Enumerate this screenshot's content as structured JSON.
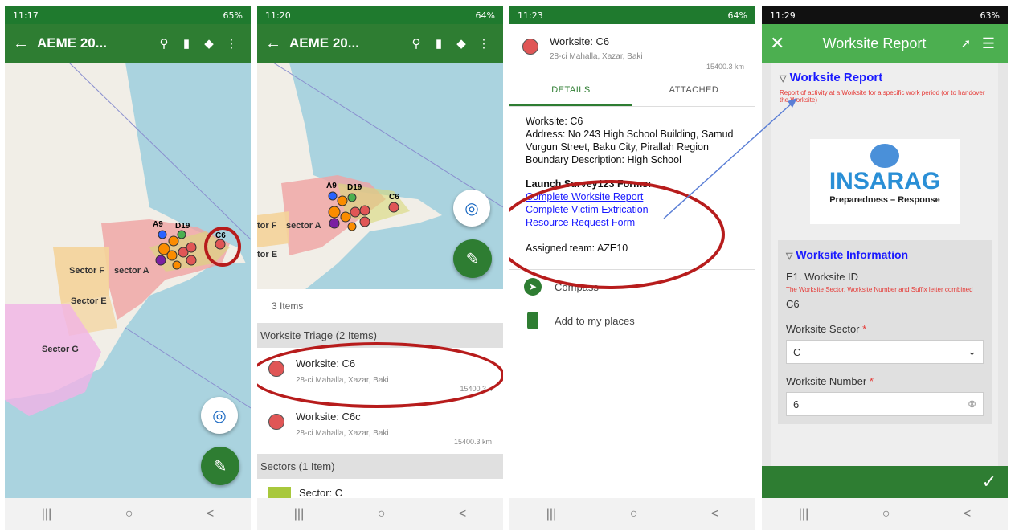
{
  "phone1": {
    "status": {
      "time": "11:17",
      "battery": "65%"
    },
    "appbar": {
      "title": "AEME 20..."
    },
    "map": {
      "labels": {
        "a9": "A9",
        "d19": "D19",
        "c6": "C6",
        "sector_f": "Sector F",
        "sector_a": "sector A",
        "sector_e": "Sector E",
        "sector_g": "Sector G"
      }
    }
  },
  "phone2": {
    "status": {
      "time": "11:20",
      "battery": "64%"
    },
    "appbar": {
      "title": "AEME 20..."
    },
    "map": {
      "labels": {
        "a9": "A9",
        "d19": "D19",
        "c6": "C6",
        "sector_f": "tor F",
        "sector_a": "sector A",
        "sector_e": "tor E"
      }
    },
    "list": {
      "count": "3 Items",
      "triage_header": "Worksite Triage (2 Items)",
      "items": [
        {
          "title": "Worksite: C6",
          "address": "28-ci Mahalla, Xazar, Baki",
          "distance": "15400.3 k"
        },
        {
          "title": "Worksite: C6c",
          "address": "28-ci Mahalla, Xazar, Baki",
          "distance": "15400.3 km"
        }
      ],
      "sectors_header": "Sectors (1 Item)",
      "sector_item": "Sector: C",
      "sector_color": "#a8c83c"
    }
  },
  "phone3": {
    "status": {
      "time": "11:23",
      "battery": "64%"
    },
    "header": {
      "title": "Worksite: C6",
      "address": "28-ci Mahalla, Xazar, Baki",
      "distance": "15400.3 km"
    },
    "tabs": {
      "details": "DETAILS",
      "attached": "ATTACHED"
    },
    "details": {
      "worksite": "Worksite: C6",
      "address": "Address: No 243 High School Building, Samud Vurgun Street, Baku City, Pirallah Region",
      "boundary": "Boundary Description: High School",
      "launch": "Launch Survey123 Forms:",
      "link1": "Complete Worksite Report",
      "link2": "Complete Victim Extrication",
      "link3": "Resource Request Form",
      "team": "Assigned team: AZE10"
    },
    "actions": {
      "compass": "Compass",
      "places": "Add to my places"
    }
  },
  "phone4": {
    "status": {
      "time": "11:29",
      "battery": "63%"
    },
    "appbar": {
      "title": "Worksite Report"
    },
    "form": {
      "header": "Worksite Report",
      "desc": "Report of activity at a Worksite for a specific work period (or to handover the Worksite)",
      "logo_text": "INSARAG",
      "logo_sub": "Preparedness – Response",
      "section": "Worksite Information",
      "e1_label": "E1. Worksite ID",
      "e1_hint": "The Worksite Sector, Worksite Number and Suffix letter combined",
      "e1_value": "C6",
      "sector_label": "Worksite Sector",
      "sector_value": "C",
      "number_label": "Worksite Number",
      "number_value": "6",
      "required": "*"
    }
  },
  "colors": {
    "green": "#2e7d32",
    "ring": "#b71c1c",
    "link": "#1a1aff",
    "hint": "#e53935"
  }
}
